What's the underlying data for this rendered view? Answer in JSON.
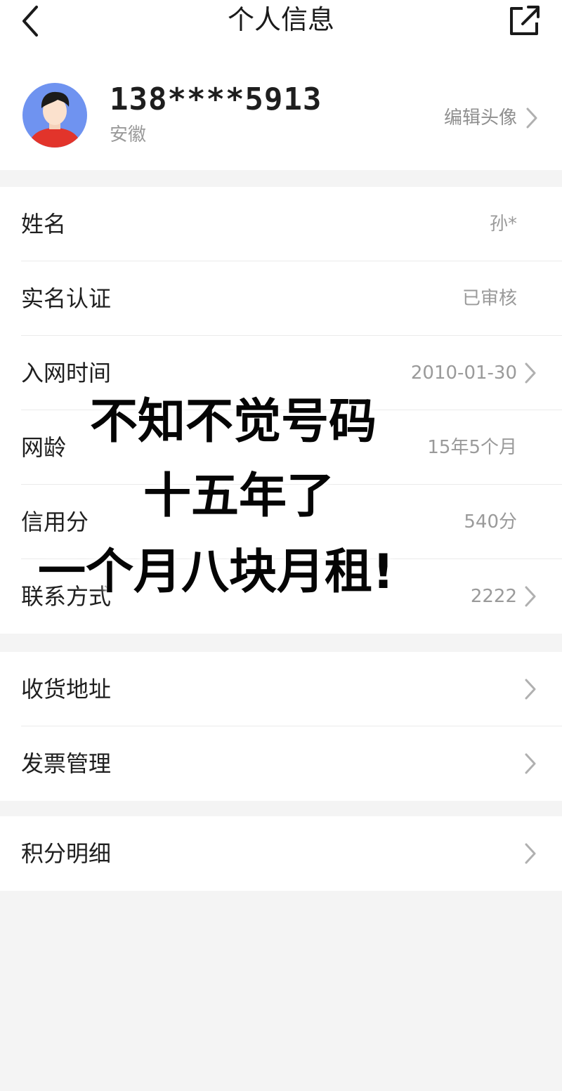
{
  "header": {
    "title": "个人信息",
    "back_icon": "chevron-left-icon",
    "share_icon": "share-icon"
  },
  "profile": {
    "phone": "138****5913",
    "region": "安徽",
    "edit_avatar_label": "编辑头像",
    "avatar_icon": "user-avatar-icon"
  },
  "info": [
    {
      "label": "姓名",
      "value": "孙*",
      "chevron": false
    },
    {
      "label": "实名认证",
      "value": "已审核",
      "chevron": false
    },
    {
      "label": "入网时间",
      "value": "2010-01-30",
      "chevron": true
    },
    {
      "label": "网龄",
      "value": "15年5个月",
      "chevron": false
    },
    {
      "label": "信用分",
      "value": "540分",
      "chevron": false
    },
    {
      "label": "联系方式",
      "value": "2222",
      "chevron": true
    }
  ],
  "services": [
    {
      "label": "收货地址",
      "chevron": true
    },
    {
      "label": "发票管理",
      "chevron": true
    }
  ],
  "points": [
    {
      "label": "积分明细",
      "chevron": true
    }
  ],
  "overlay": {
    "line1": "不知不觉号码",
    "line2": "十五年了",
    "line3": "一个月八块月租!"
  },
  "colors": {
    "background": "#f4f4f4",
    "card": "#ffffff",
    "secondary_text": "#9a9a9a"
  }
}
